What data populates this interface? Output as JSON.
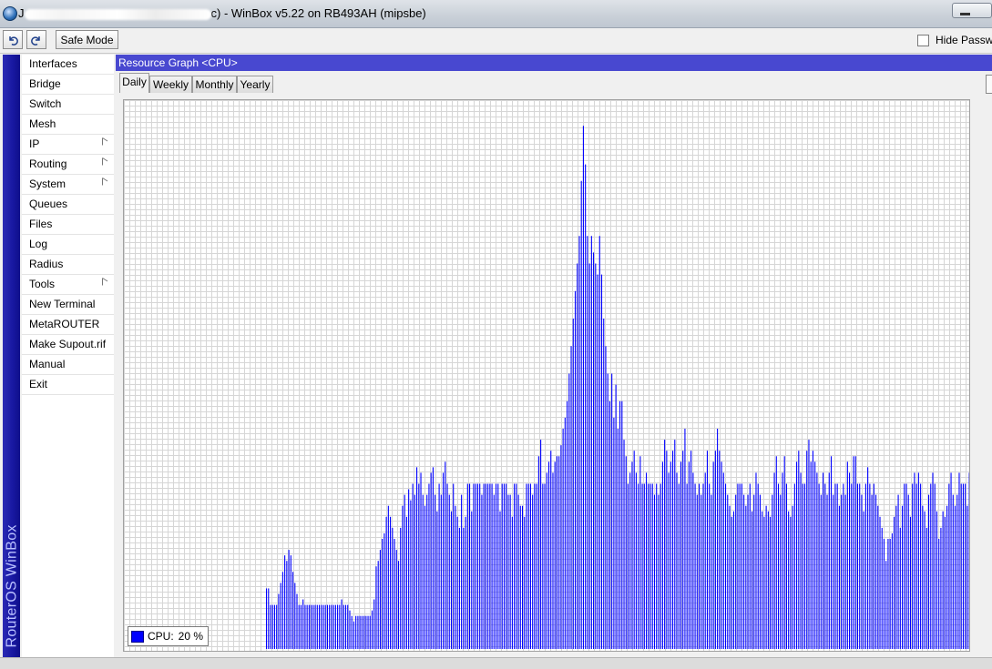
{
  "window": {
    "title_suffix": "c) - WinBox v5.22 on RB493AH (mipsbe)",
    "prefix_char": "J",
    "colors": {
      "title_bar": "#c9d0d8",
      "brand": "#1717a0",
      "header": "#4848d0",
      "bar": "#0000ff"
    }
  },
  "toolbar": {
    "undo_icon": "undo-arrow-icon",
    "redo_icon": "redo-arrow-icon",
    "safe_mode_label": "Safe Mode",
    "hide_passwords_label": "Hide Passwords",
    "hide_passwords_checked": false
  },
  "brand": {
    "text": "RouterOS WinBox"
  },
  "menu": {
    "items": [
      {
        "label": "Interfaces",
        "submenu": false
      },
      {
        "label": "Bridge",
        "submenu": false
      },
      {
        "label": "Switch",
        "submenu": false
      },
      {
        "label": "Mesh",
        "submenu": false
      },
      {
        "label": "IP",
        "submenu": true
      },
      {
        "label": "Routing",
        "submenu": true
      },
      {
        "label": "System",
        "submenu": true
      },
      {
        "label": "Queues",
        "submenu": false
      },
      {
        "label": "Files",
        "submenu": false
      },
      {
        "label": "Log",
        "submenu": false
      },
      {
        "label": "Radius",
        "submenu": false
      },
      {
        "label": "Tools",
        "submenu": true
      },
      {
        "label": "New Terminal",
        "submenu": false
      },
      {
        "label": "MetaROUTER",
        "submenu": false
      },
      {
        "label": "Make Supout.rif",
        "submenu": false
      },
      {
        "label": "Manual",
        "submenu": false
      },
      {
        "label": "Exit",
        "submenu": false
      }
    ]
  },
  "panel": {
    "title": "Resource Graph <CPU>",
    "tabs": [
      {
        "label": "Daily",
        "active": true
      },
      {
        "label": "Weekly",
        "active": false
      },
      {
        "label": "Monthly",
        "active": false
      },
      {
        "label": "Yearly",
        "active": false
      }
    ]
  },
  "chart_data": {
    "type": "bar",
    "ylim": [
      0,
      100
    ],
    "grid": true,
    "legend": {
      "placement": "bottom-left",
      "label": "CPU:",
      "value": "20 %"
    },
    "series": [
      {
        "values": [
          11,
          11,
          8,
          8,
          8,
          8,
          10,
          12,
          14,
          17,
          16,
          18,
          17,
          14,
          12,
          10,
          8,
          8,
          9,
          8,
          8,
          8,
          8,
          8,
          8,
          8,
          8,
          8,
          8,
          8,
          8,
          8,
          8,
          8,
          8,
          8,
          8,
          9,
          8,
          8,
          8,
          7,
          6,
          5,
          6,
          6,
          6,
          6,
          6,
          6,
          6,
          6,
          7,
          9,
          15,
          16,
          18,
          20,
          21,
          24,
          26,
          24,
          22,
          20,
          18,
          16,
          22,
          26,
          28,
          24,
          29,
          27,
          30,
          28,
          33,
          30,
          32,
          28,
          26,
          28,
          30,
          32,
          33,
          28,
          25,
          30,
          28,
          32,
          34,
          30,
          28,
          25,
          30,
          26,
          24,
          22,
          28,
          22,
          24,
          30,
          30,
          25,
          30,
          30,
          30,
          30,
          28,
          30,
          30,
          30,
          30,
          30,
          28,
          30,
          30,
          25,
          30,
          30,
          30,
          28,
          28,
          24,
          30,
          30,
          28,
          26,
          26,
          24,
          30,
          30,
          30,
          28,
          30,
          30,
          35,
          38,
          30,
          30,
          32,
          34,
          36,
          32,
          34,
          35,
          35,
          37,
          40,
          42,
          45,
          50,
          55,
          60,
          65,
          70,
          75,
          85,
          95,
          88,
          75,
          70,
          75,
          72,
          70,
          68,
          75,
          68,
          60,
          55,
          50,
          45,
          50,
          42,
          48,
          40,
          45,
          45,
          38,
          35,
          30,
          32,
          34,
          36,
          32,
          30,
          35,
          30,
          30,
          32,
          30,
          30,
          30,
          28,
          30,
          28,
          30,
          34,
          38,
          36,
          32,
          34,
          36,
          38,
          32,
          30,
          34,
          36,
          40,
          30,
          34,
          36,
          32,
          30,
          28,
          30,
          28,
          30,
          32,
          36,
          30,
          28,
          34,
          36,
          40,
          36,
          34,
          32,
          30,
          28,
          26,
          24,
          25,
          28,
          30,
          30,
          30,
          28,
          26,
          28,
          30,
          25,
          28,
          32,
          30,
          28,
          25,
          24,
          26,
          25,
          24,
          28,
          32,
          35,
          30,
          28,
          32,
          35,
          30,
          25,
          24,
          26,
          30,
          34,
          36,
          32,
          30,
          30,
          36,
          38,
          34,
          36,
          34,
          32,
          30,
          28,
          32,
          30,
          28,
          32,
          35,
          28,
          30,
          30,
          26,
          28,
          30,
          28,
          34,
          32,
          30,
          35,
          35,
          30,
          30,
          28,
          25,
          30,
          33,
          30,
          28,
          30,
          28,
          26,
          24,
          22,
          20,
          16,
          20,
          20,
          21,
          24,
          26,
          28,
          22,
          26,
          30,
          30,
          28,
          24,
          30,
          32,
          30,
          32,
          30,
          26,
          25,
          22,
          28,
          30,
          32,
          30,
          25,
          20,
          22,
          25,
          24,
          26,
          30,
          32,
          28,
          26,
          28,
          32,
          30,
          30,
          30,
          26,
          32,
          30,
          22,
          24,
          27,
          34
        ]
      }
    ]
  }
}
